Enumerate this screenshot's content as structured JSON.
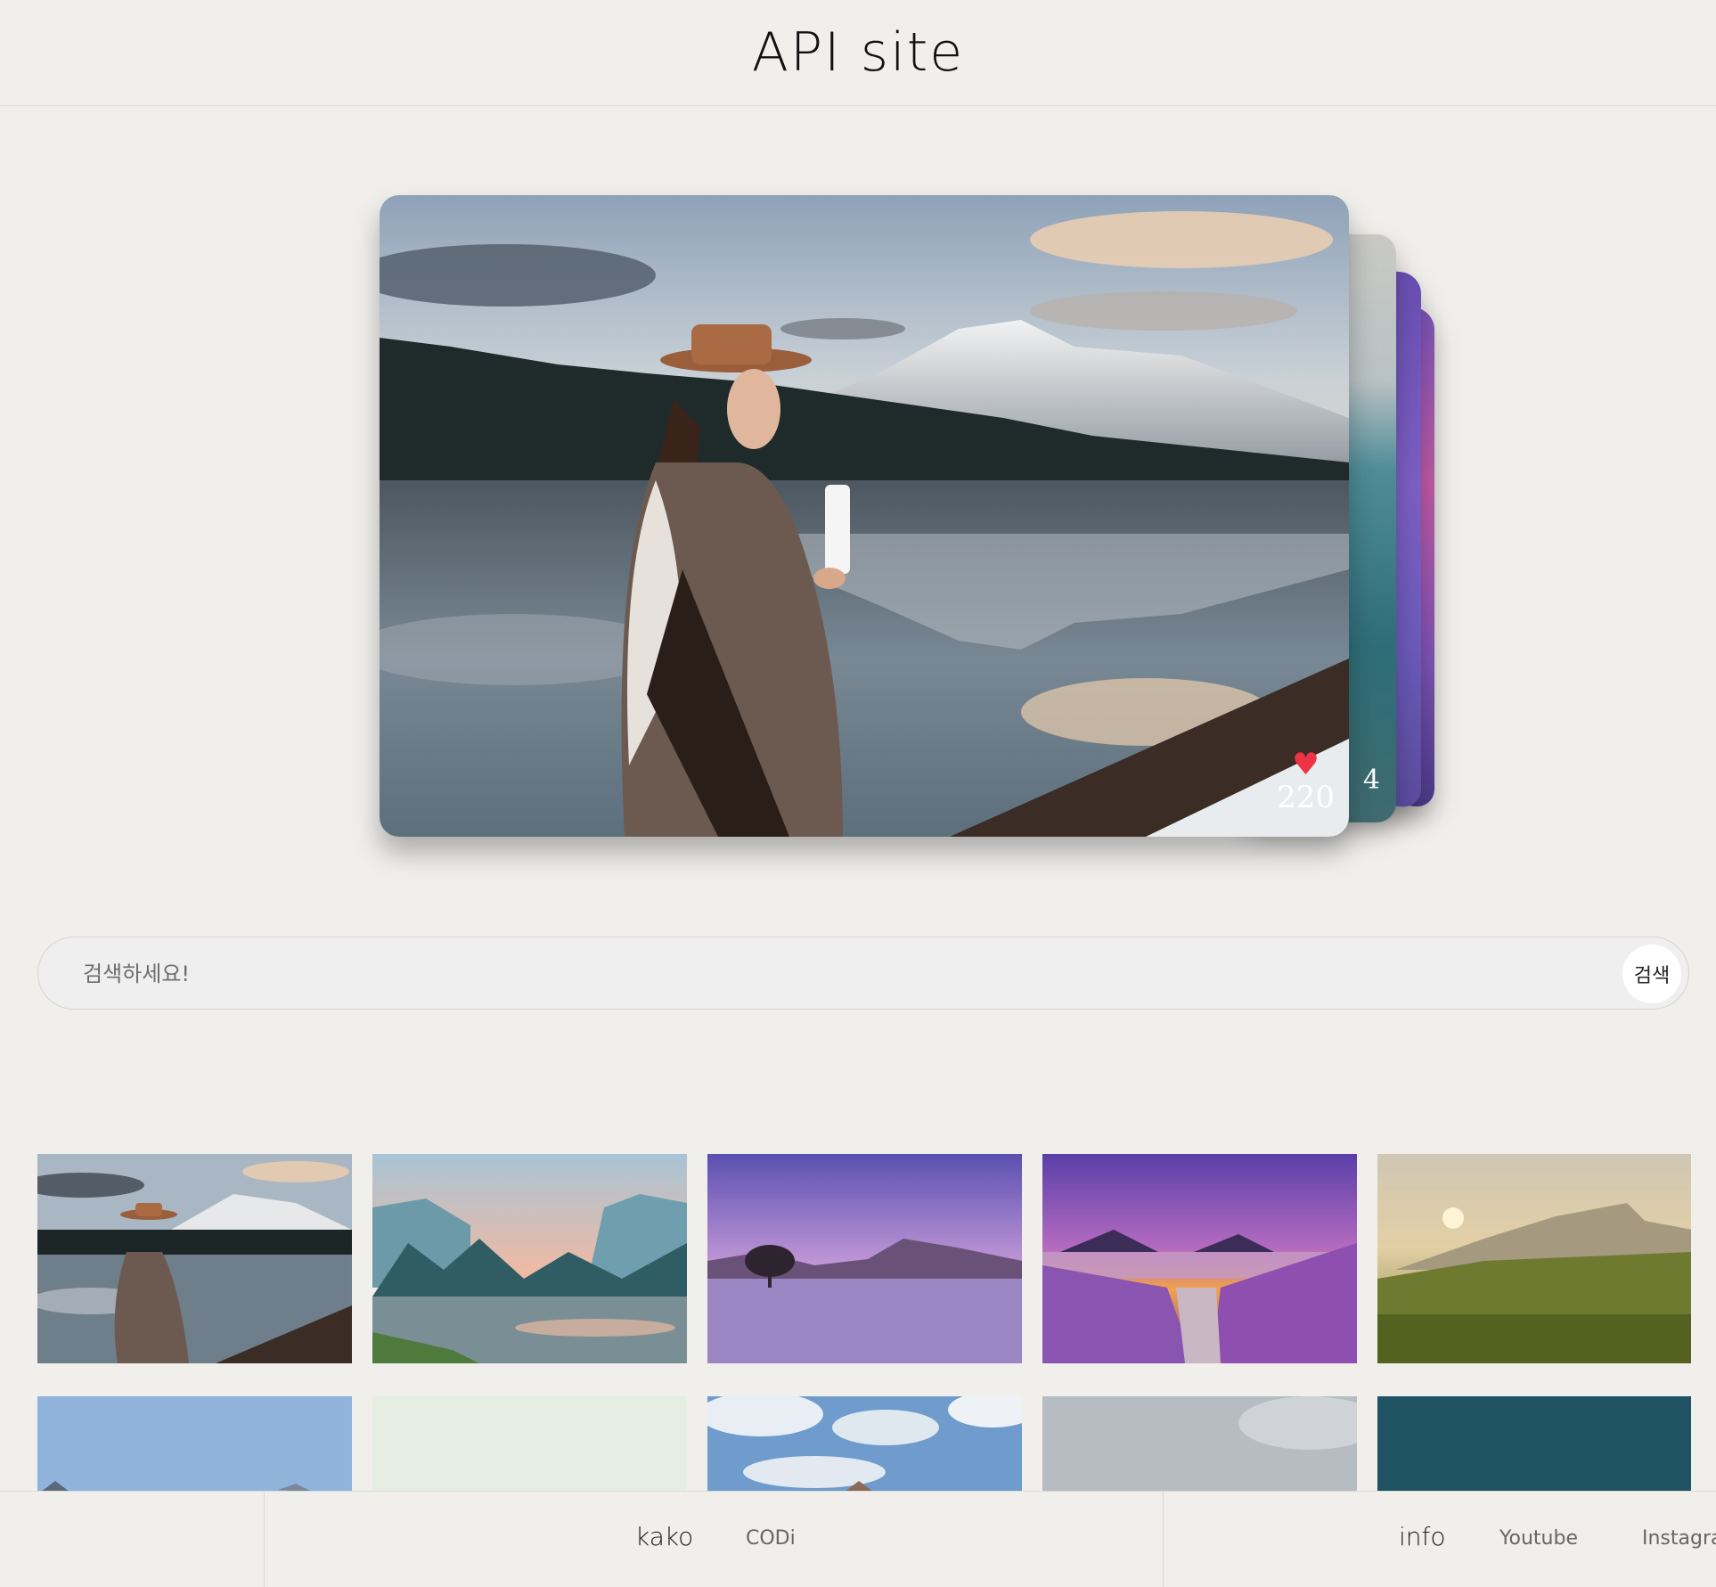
{
  "header": {
    "title": "API site"
  },
  "hero": {
    "main_likes": "220",
    "behind_likes": "4",
    "heart_color": "#ee3344"
  },
  "search": {
    "placeholder": "검색하세요!",
    "button_label": "검색"
  },
  "gallery": {
    "tiles": [
      "lake-woman-hat",
      "forest-river-valley",
      "purple-lake-tree",
      "lavender-volcano-sunset",
      "golden-meadow-mountain",
      "blue-sky-hills",
      "misty-green",
      "clouds-sky",
      "grey-mist",
      "teal-dark"
    ]
  },
  "footer": {
    "left_brand": "kako",
    "left_link": "CODi",
    "right_brand": "info",
    "right_links": [
      "Youtube",
      "Instagra"
    ]
  }
}
